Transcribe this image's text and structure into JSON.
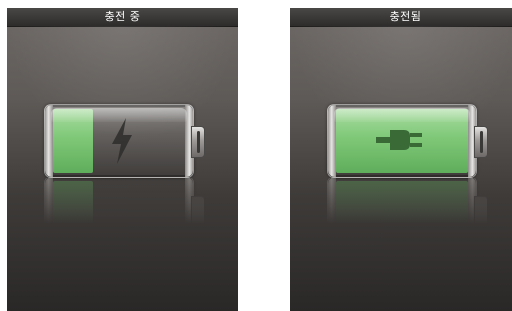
{
  "screens": [
    {
      "title": "충전 중",
      "charge_level": 0.3,
      "icon": "lightning-bolt-icon"
    },
    {
      "title": "충전됨",
      "charge_level": 1.0,
      "icon": "power-plug-icon"
    }
  ],
  "colors": {
    "fill_green": "#7fc878",
    "title_bar": "#3a3837",
    "background_top": "#6e6966",
    "background_bottom": "#2a2827"
  }
}
